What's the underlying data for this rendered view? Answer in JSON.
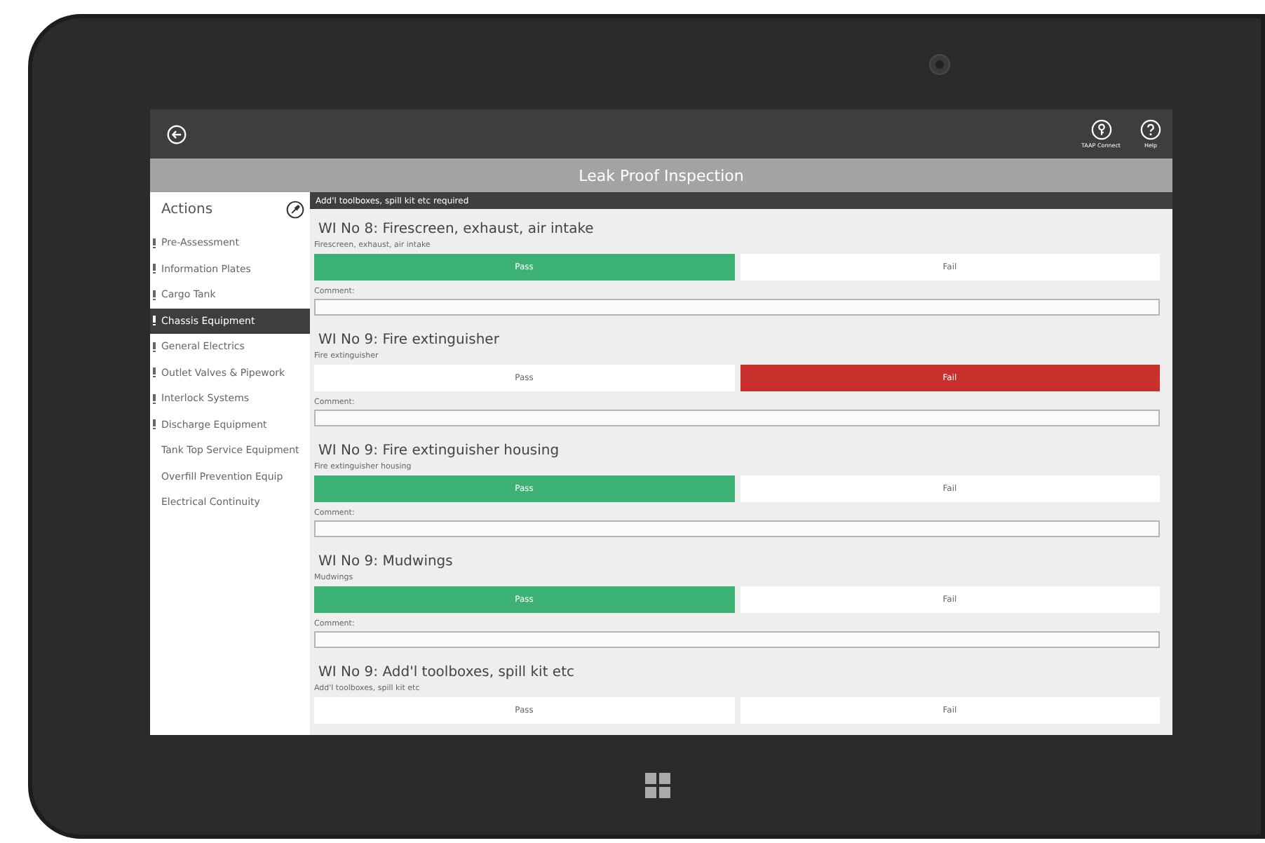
{
  "top_bar": {
    "actions": [
      {
        "kind": "connect",
        "label": "TAAP Connect"
      },
      {
        "kind": "help",
        "label": "Help"
      }
    ]
  },
  "title_bar": {
    "title": "Leak Proof Inspection"
  },
  "sidebar": {
    "title": "Actions",
    "items": [
      {
        "label": "Pre-Assessment",
        "flagged": true,
        "selected": false
      },
      {
        "label": "Information Plates",
        "flagged": true,
        "selected": false
      },
      {
        "label": "Cargo Tank",
        "flagged": true,
        "selected": false
      },
      {
        "label": "Chassis Equipment",
        "flagged": true,
        "selected": true
      },
      {
        "label": "General Electrics",
        "flagged": true,
        "selected": false
      },
      {
        "label": "Outlet Valves & Pipework",
        "flagged": true,
        "selected": false
      },
      {
        "label": "Interlock Systems",
        "flagged": true,
        "selected": false
      },
      {
        "label": "Discharge Equipment",
        "flagged": true,
        "selected": false
      },
      {
        "label": "Tank Top Service Equipment",
        "flagged": false,
        "selected": false
      },
      {
        "label": "Overfill Prevention Equip",
        "flagged": false,
        "selected": false
      },
      {
        "label": "Electrical Continuity",
        "flagged": false,
        "selected": false
      }
    ]
  },
  "banner": "Add'l toolboxes, spill kit etc required",
  "checks": [
    {
      "title": "WI No 8: Firescreen, exhaust, air intake",
      "subtitle": "Firescreen, exhaust, air intake",
      "options": [
        {
          "kind": "pass",
          "label": "Pass",
          "selected": true
        },
        {
          "kind": "fail",
          "label": "Fail",
          "selected": false
        }
      ],
      "comment_label": "Comment:"
    },
    {
      "title": "WI No 9: Fire extinguisher",
      "subtitle": "Fire extinguisher",
      "options": [
        {
          "kind": "pass",
          "label": "Pass",
          "selected": false
        },
        {
          "kind": "fail",
          "label": "Fail",
          "selected": true
        }
      ],
      "comment_label": "Comment:"
    },
    {
      "title": "WI No 9: Fire extinguisher housing",
      "subtitle": "Fire extinguisher housing",
      "options": [
        {
          "kind": "pass",
          "label": "Pass",
          "selected": true
        },
        {
          "kind": "fail",
          "label": "Fail",
          "selected": false
        }
      ],
      "comment_label": "Comment:"
    },
    {
      "title": "WI No 9: Mudwings",
      "subtitle": "Mudwings",
      "options": [
        {
          "kind": "pass",
          "label": "Pass",
          "selected": true
        },
        {
          "kind": "fail",
          "label": "Fail",
          "selected": false
        }
      ],
      "comment_label": "Comment:"
    },
    {
      "title": "WI No 9: Add'l toolboxes, spill kit etc",
      "subtitle": "Add'l toolboxes, spill kit etc",
      "options": [
        {
          "kind": "pass",
          "label": "Pass",
          "selected": false
        },
        {
          "kind": "fail",
          "label": "Fail",
          "selected": false
        }
      ]
    }
  ]
}
